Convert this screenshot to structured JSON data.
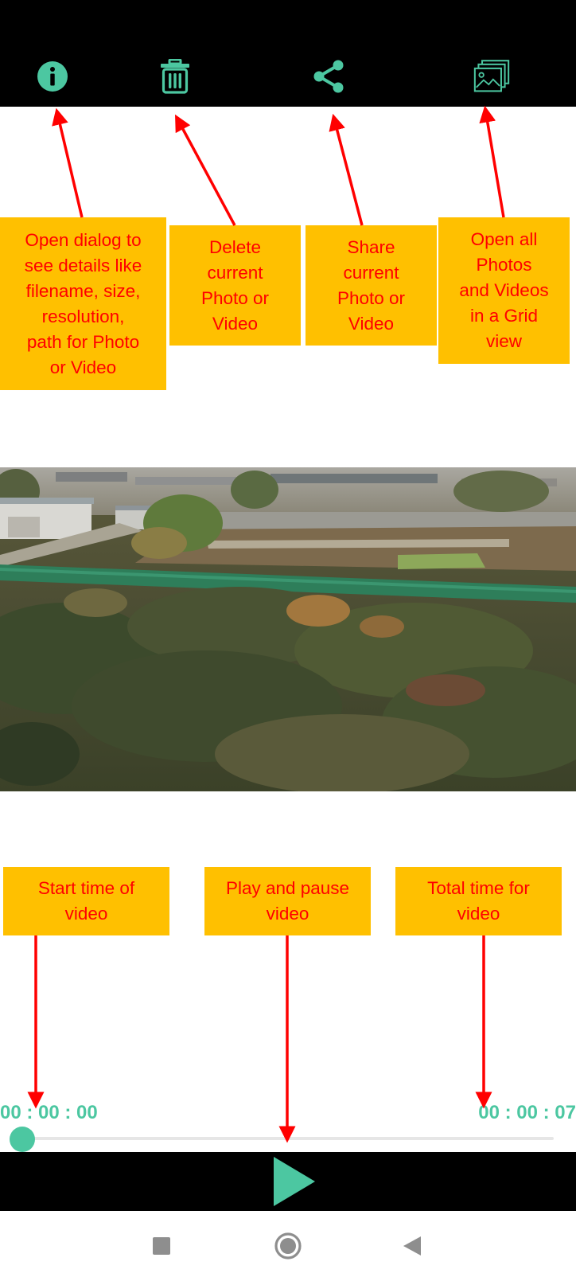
{
  "colors": {
    "accent": "#4cc7a1",
    "callout_bg": "#ffc000",
    "callout_text": "#ff0000",
    "arrow": "#ff0000",
    "bars": "#000000"
  },
  "toolbar": {
    "icons": [
      {
        "name": "info-icon"
      },
      {
        "name": "trash-icon"
      },
      {
        "name": "share-icon"
      },
      {
        "name": "gallery-icon"
      }
    ]
  },
  "callouts": {
    "info": [
      "Open dialog to",
      "see details like",
      "filename, size,",
      "resolution,",
      "path for Photo",
      "or Video"
    ],
    "delete": [
      "Delete",
      "current",
      "Photo or",
      "Video"
    ],
    "share": [
      "Share",
      "current",
      "Photo or",
      "Video"
    ],
    "grid": [
      "Open all",
      "Photos",
      "and Videos",
      "in a Grid",
      "view"
    ],
    "start_time": [
      "Start time of",
      "video"
    ],
    "play_pause": [
      "Play and pause",
      "video"
    ],
    "total_time": [
      "Total time for",
      "video"
    ]
  },
  "player": {
    "current_time": "00 : 00 : 00",
    "total_time": "00 : 00 : 07",
    "progress": 0.0
  },
  "navbar": {
    "icons": [
      "recents-square-icon",
      "home-circle-icon",
      "back-triangle-icon"
    ]
  }
}
